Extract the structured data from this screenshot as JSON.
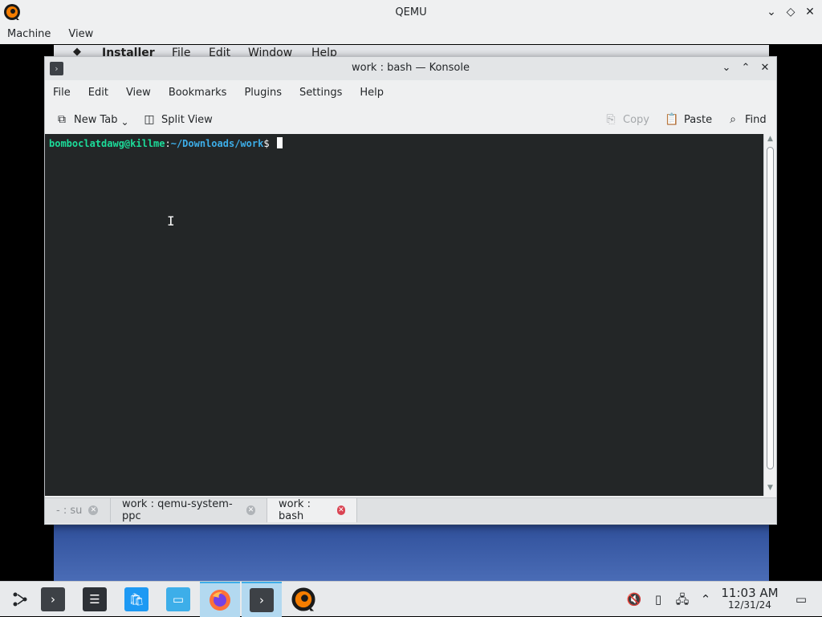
{
  "qemu": {
    "title": "QEMU",
    "menu": [
      "Machine",
      "View"
    ],
    "controls": {
      "minimize_icon": "chevron-down-icon",
      "maximize_icon": "diamond-icon",
      "close_icon": "close-icon"
    }
  },
  "guest": {
    "background_window_menu": [
      "Installer",
      "File",
      "Edit",
      "Window",
      "Help"
    ]
  },
  "konsole": {
    "title": "work : bash — Konsole",
    "menu": [
      "File",
      "Edit",
      "View",
      "Bookmarks",
      "Plugins",
      "Settings",
      "Help"
    ],
    "toolbar": {
      "new_tab": "New Tab",
      "split_view": "Split View",
      "copy": "Copy",
      "paste": "Paste",
      "find": "Find"
    },
    "terminal": {
      "user_host": "bomboclatdawg@killme",
      "colon": ":",
      "path": "~/Downloads/work",
      "dollar": "$ "
    },
    "tabs": [
      {
        "label": "- : su",
        "active": false
      },
      {
        "label": "work : qemu-system-ppc",
        "active": false
      },
      {
        "label": "work : bash",
        "active": true
      }
    ]
  },
  "taskbar": {
    "clock": {
      "time": "11:03 AM",
      "date": "12/31/24"
    }
  },
  "colors": {
    "terminal_bg": "#232627",
    "prompt_user": "#1cdc9a",
    "prompt_path": "#3daee9",
    "accent": "#3daee9",
    "close_red": "#da4453"
  }
}
